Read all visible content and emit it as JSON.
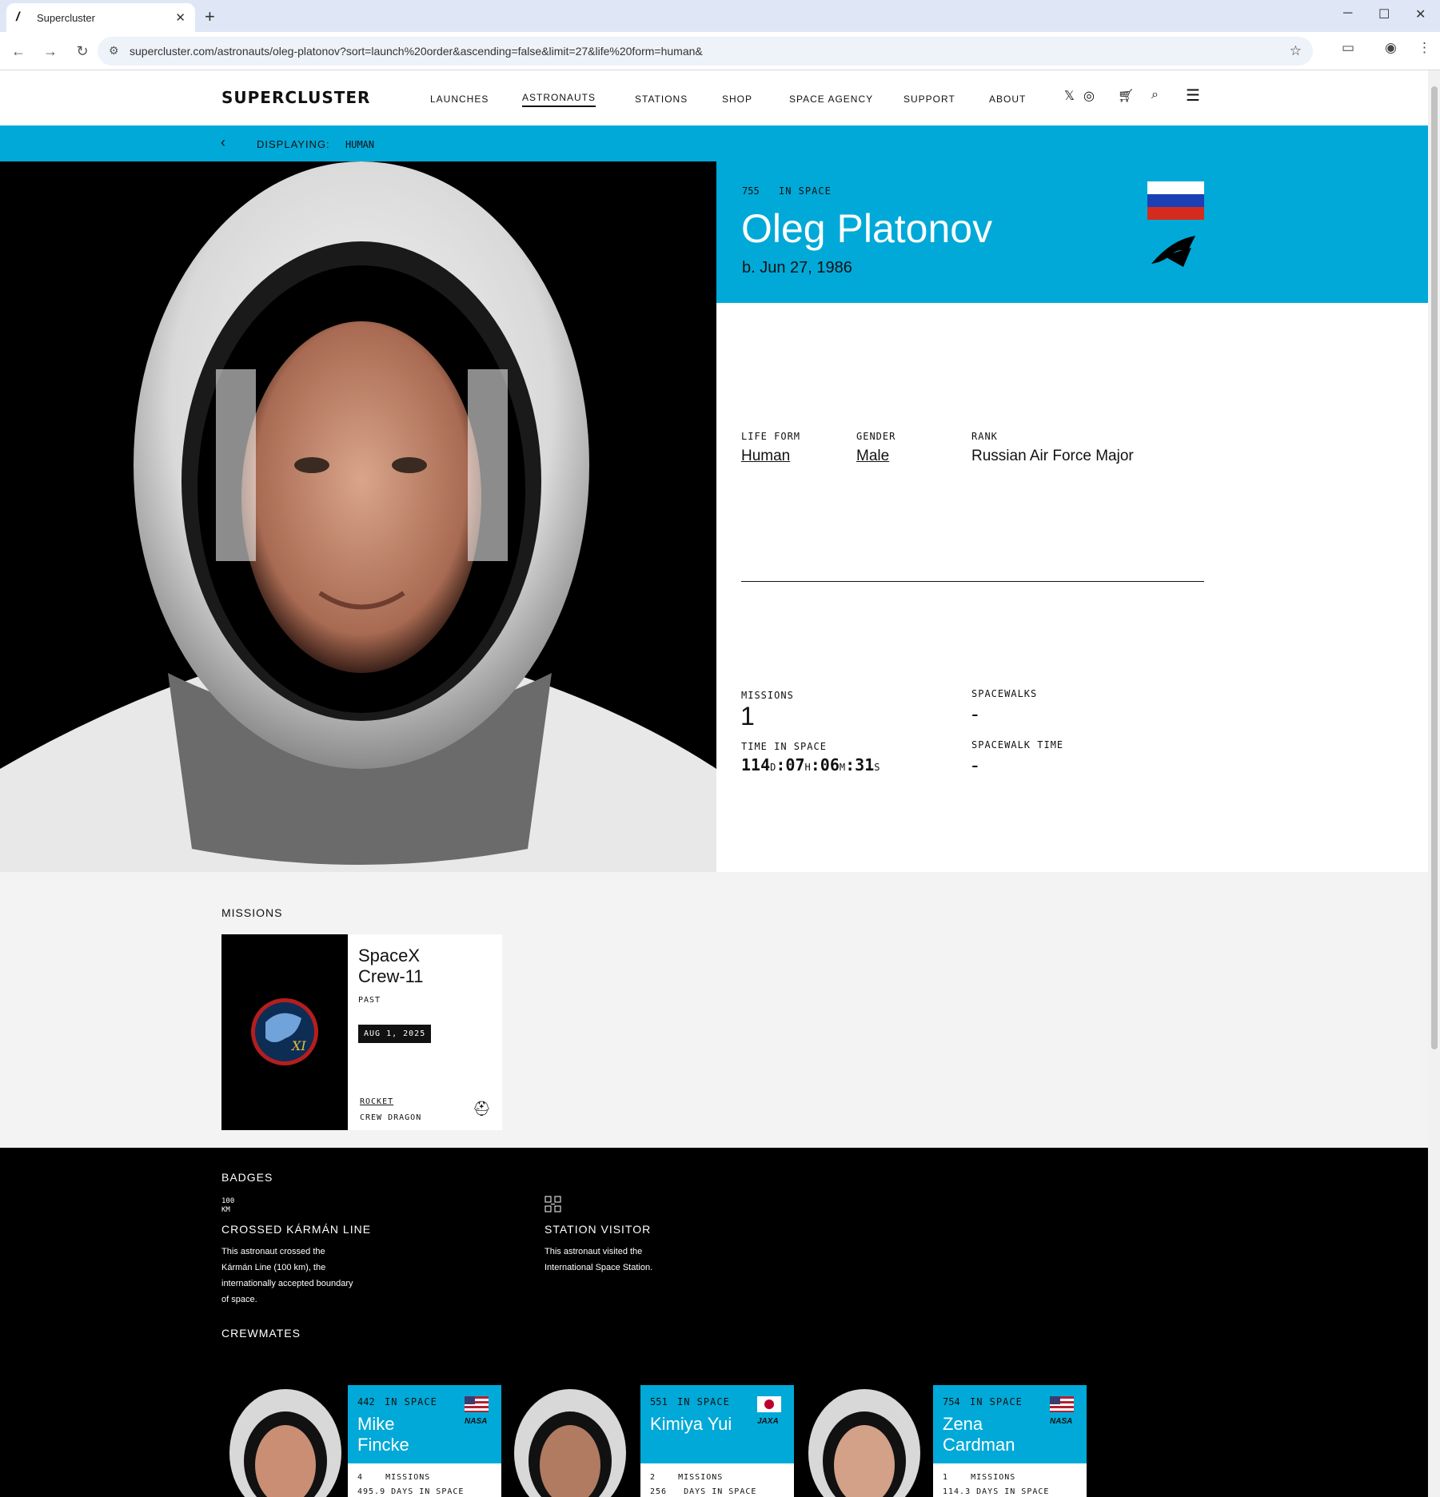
{
  "browser": {
    "tab_title": "Supercluster",
    "url": "supercluster.com/astronauts/oleg-platonov?sort=launch%20order&ascending=false&limit=27&life%20form=human&"
  },
  "site": {
    "logo": "SUPERCLUSTER",
    "nav": [
      "LAUNCHES",
      "ASTRONAUTS",
      "STATIONS",
      "SHOP",
      "SPACE AGENCY",
      "SUPPORT",
      "ABOUT"
    ],
    "displaying_label": "DISPLAYING:",
    "displaying_value": "HUMAN"
  },
  "astronaut": {
    "number": "755",
    "in_space": "IN SPACE",
    "name": "Oleg Platonov",
    "born": "b. Jun 27, 1986",
    "flag": "russia-flag",
    "agency_icon": "roscosmos-logo-icon",
    "life_form_label": "LIFE FORM",
    "life_form": "Human",
    "gender_label": "GENDER",
    "gender": "Male",
    "rank_label": "RANK",
    "rank": "Russian Air Force Major",
    "missions_label": "MISSIONS",
    "missions": "1",
    "spacewalks_label": "SPACEWALKS",
    "spacewalks": "-",
    "time_label": "TIME IN SPACE",
    "time": {
      "d": "114",
      "h": "07",
      "m": "06",
      "s": "31"
    },
    "time_units": {
      "d": "D",
      "h": "H",
      "m": "M",
      "s": "S"
    },
    "spacewalk_time_label": "SPACEWALK TIME",
    "spacewalk_time": "-"
  },
  "missions_section": {
    "heading": "MISSIONS",
    "cards": [
      {
        "name": "SpaceX\nCrew-11",
        "status": "PAST",
        "date": "AUG 1, 2025",
        "rocket_label": "ROCKET",
        "rocket": "CREW DRAGON"
      }
    ]
  },
  "badges_section": {
    "heading": "BADGES",
    "badges": [
      {
        "icon_text": "100\nKM",
        "title": "CROSSED KÁRMÁN LINE",
        "description": "This astronaut crossed the Kármán Line (100 km), the internationally accepted boundary of space."
      },
      {
        "icon": "station-icon",
        "title": "STATION VISITOR",
        "description": "This astronaut visited the International Space Station."
      }
    ]
  },
  "crewmates_section": {
    "heading": "CREWMATES",
    "crewmates": [
      {
        "number": "442",
        "in_space": "IN SPACE",
        "name": "Mike\nFincke",
        "agency": "NASA",
        "missions_count": "4",
        "missions_label": "MISSIONS",
        "days": "495.9",
        "days_label": "DAYS IN SPACE"
      },
      {
        "number": "551",
        "in_space": "IN SPACE",
        "name": "Kimiya Yui",
        "agency": "JAXA",
        "missions_count": "2",
        "missions_label": "MISSIONS",
        "days": "256",
        "days_label": "DAYS IN SPACE"
      },
      {
        "number": "754",
        "in_space": "IN SPACE",
        "name": "Zena\nCardman",
        "agency": "NASA",
        "missions_count": "1",
        "missions_label": "MISSIONS",
        "days": "114.3",
        "days_label": "DAYS IN SPACE"
      }
    ]
  },
  "colors": {
    "accent": "#00a9d8",
    "dark": "#000000",
    "light_bg": "#f3f3f3"
  }
}
